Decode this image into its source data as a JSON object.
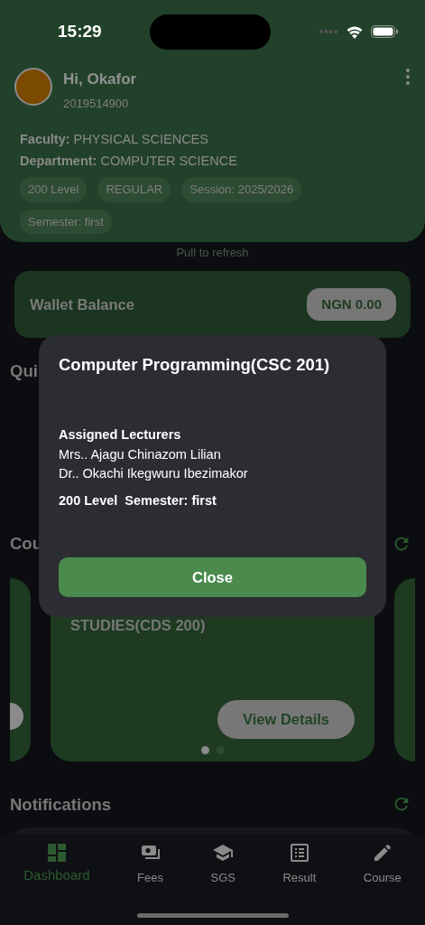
{
  "status_bar": {
    "time": "15:29"
  },
  "profile": {
    "greeting": "Hi, Okafor",
    "id_number": "2019514900",
    "faculty_label": "Faculty:",
    "faculty": "PHYSICAL SCIENCES",
    "department_label": "Department:",
    "department": "COMPUTER SCIENCE",
    "chips": [
      "200 Level",
      "REGULAR",
      "Session: 2025/2026",
      "Semester: first"
    ]
  },
  "pull_hint": "Pull to refresh",
  "wallet": {
    "label": "Wallet Balance",
    "amount": "NGN 0.00"
  },
  "sections": [
    {
      "heading": "Qui"
    },
    {
      "heading": "Cou"
    }
  ],
  "course_carousel": {
    "card_title": "STUDIES(CDS 200)",
    "button": "View Details",
    "dots": [
      {
        "selected": true
      },
      {
        "selected": false
      }
    ]
  },
  "notifications": {
    "heading": "Notifications"
  },
  "bottom_nav": [
    {
      "label": "Dashboard",
      "selected": true
    },
    {
      "label": "Fees",
      "selected": false
    },
    {
      "label": "SGS",
      "selected": false
    },
    {
      "label": "Result",
      "selected": false
    },
    {
      "label": "Course",
      "selected": false
    }
  ],
  "modal": {
    "title": "Computer Programming(CSC 201)",
    "lecturers_heading": "Assigned Lecturers",
    "lecturers": [
      "Mrs.. Ajagu Chinazom Lilian",
      "Dr.. Okachi Ikegwuru Ibezimakor"
    ],
    "level": "200 Level",
    "semester": "Semester: first",
    "button": "Close"
  }
}
